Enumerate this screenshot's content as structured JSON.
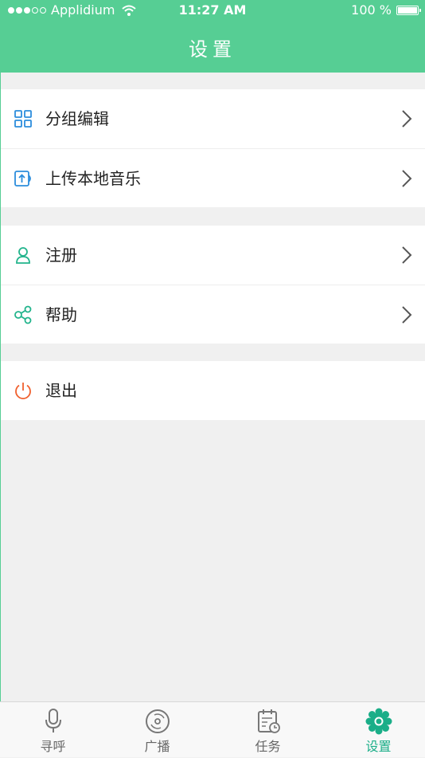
{
  "status_bar": {
    "carrier": "Applidium",
    "time": "11:27 AM",
    "battery": "100 %"
  },
  "header": {
    "title": "设置"
  },
  "menu_groups": [
    {
      "items": [
        {
          "label": "分组编辑",
          "icon": "grid-icon",
          "has_arrow": true
        },
        {
          "label": "上传本地音乐",
          "icon": "upload-music-icon",
          "has_arrow": true
        }
      ]
    },
    {
      "items": [
        {
          "label": "注册",
          "icon": "user-icon",
          "has_arrow": true
        },
        {
          "label": "帮助",
          "icon": "share-nodes-icon",
          "has_arrow": true
        }
      ]
    },
    {
      "items": [
        {
          "label": "退出",
          "icon": "power-icon",
          "has_arrow": false
        }
      ]
    }
  ],
  "tab_bar": {
    "tabs": [
      {
        "label": "寻呼",
        "icon": "microphone-icon",
        "active": false
      },
      {
        "label": "广播",
        "icon": "disc-icon",
        "active": false
      },
      {
        "label": "任务",
        "icon": "calendar-clock-icon",
        "active": false
      },
      {
        "label": "设置",
        "icon": "settings-gear-icon",
        "active": true
      }
    ]
  },
  "colors": {
    "brand_green": "#56ce94",
    "active_tab": "#1aae88",
    "icon_blue": "#2c8ddc",
    "icon_teal": "#22b48c",
    "exit_orange": "#f0602e"
  }
}
